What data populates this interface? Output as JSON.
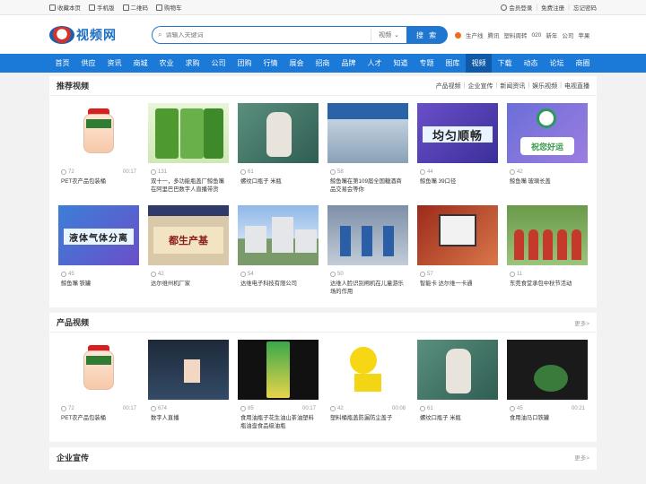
{
  "topbar": {
    "left": [
      "收藏本页",
      "手机版",
      "二维码",
      "购物车"
    ],
    "right": [
      "会员登录",
      "免费注册",
      "忘记密码"
    ]
  },
  "header": {
    "logo_text": "视频网",
    "search_placeholder": "请输入关键词",
    "search_scope": "视频",
    "search_button": "搜 索",
    "hot_links": [
      "生产线",
      "腾讯",
      "塑料周转",
      "020",
      "新年",
      "公司",
      "苹果"
    ]
  },
  "nav": {
    "items": [
      "首页",
      "供应",
      "资讯",
      "商城",
      "农业",
      "求购",
      "公司",
      "团购",
      "行情",
      "展会",
      "招商",
      "品牌",
      "人才",
      "知道",
      "专题",
      "图库",
      "视频",
      "下载",
      "动态",
      "论坛",
      "商圈"
    ],
    "active": "视频"
  },
  "recommended": {
    "title": "推荐视频",
    "tabs": [
      "产品视频",
      "企业宣传",
      "新闻资讯",
      "娱乐视频",
      "电视直播"
    ],
    "videos": [
      {
        "views": "72",
        "duration": "00:17",
        "title": "PET农产品包装桶"
      },
      {
        "views": "131",
        "duration": "",
        "title": "双十一，多功能瓶盖厂鲸鱼嘴在阿里巴巴数字人直播带货"
      },
      {
        "views": "61",
        "duration": "",
        "title": "螺纹口瓶子 米瓶"
      },
      {
        "views": "58",
        "duration": "",
        "title": "鲸鱼嘴在第109届全国糖酒商品交易会等你"
      },
      {
        "views": "44",
        "duration": "",
        "title": "鲸鱼嘴 39口径"
      },
      {
        "views": "42",
        "duration": "",
        "title": "鲸鱼嘴 玻璃长盖"
      },
      {
        "views": "45",
        "duration": "",
        "title": "鲸鱼嘴 铁罐"
      },
      {
        "views": "42",
        "duration": "",
        "title": "达尔维州机厂家"
      },
      {
        "views": "54",
        "duration": "",
        "title": "达维电子科技有限公司"
      },
      {
        "views": "50",
        "duration": "",
        "title": "达维人脸识别闸机在儿童游乐场的作用"
      },
      {
        "views": "57",
        "duration": "",
        "title": "智能卡 达尔维一卡通"
      },
      {
        "views": "11",
        "duration": "",
        "title": "东莞食堂承包中秋节活动"
      }
    ],
    "thumb_texts": {
      "even": "均匀顺畅",
      "gas": "液体气体分离",
      "wish": "祝您好运",
      "sign": "都生产基"
    }
  },
  "products": {
    "title": "产品视频",
    "more": "更多>",
    "videos": [
      {
        "views": "72",
        "duration": "00:17",
        "title": "PET农产品包装桶"
      },
      {
        "views": "674",
        "duration": "",
        "title": "数字人直播"
      },
      {
        "views": "85",
        "duration": "00:17",
        "title": "食用油瓶子花生油山茶油塑料瓶油壶食品级油瓶"
      },
      {
        "views": "42",
        "duration": "00:08",
        "title": "塑料桶瓶盖防漏防尘盖子"
      },
      {
        "views": "61",
        "duration": "",
        "title": "螺纹口瓶子 米瓶"
      },
      {
        "views": "45",
        "duration": "00:21",
        "title": "食用油马口铁罐"
      }
    ]
  },
  "corporate": {
    "title": "企业宣传",
    "more": "更多>"
  }
}
